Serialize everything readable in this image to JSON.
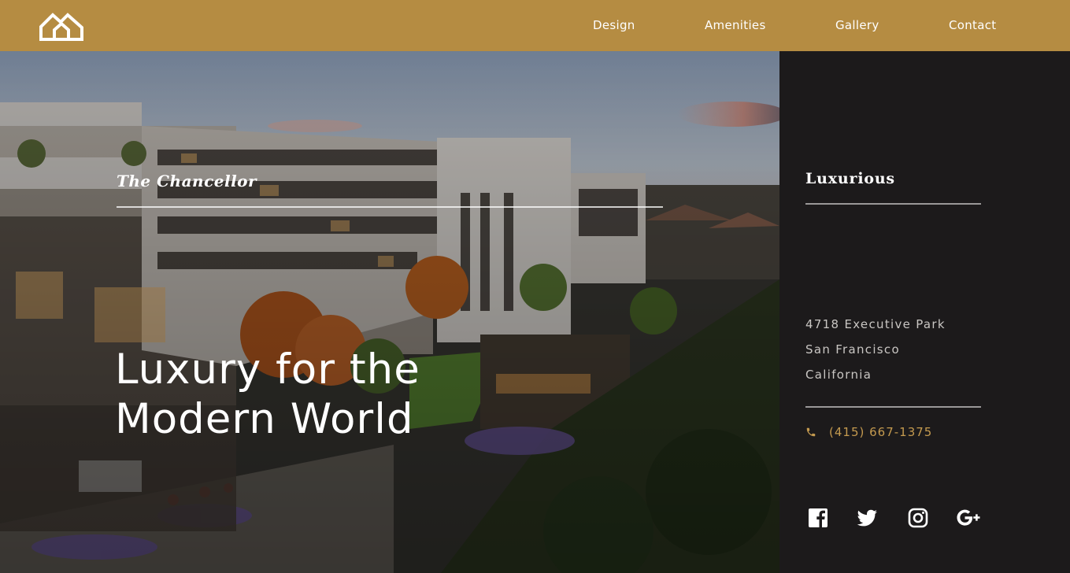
{
  "header": {
    "logo_icon": "house-outline-icon",
    "nav": [
      "Design",
      "Amenities",
      "Gallery",
      "Contact"
    ]
  },
  "hero": {
    "kicker": "The Chancellor",
    "headline_line1": "Luxury for the",
    "headline_line2": "Modern World"
  },
  "sidebar": {
    "title": "Luxurious",
    "address": [
      "4718 Executive Park",
      "San Francisco",
      "California"
    ],
    "phone": "(415) 667-1375",
    "phone_icon": "phone-icon",
    "social": [
      "facebook-icon",
      "twitter-icon",
      "instagram-icon",
      "google-plus-icon"
    ]
  },
  "colors": {
    "brand_gold": "#b58c42",
    "sidebar_bg": "#1c1a1b",
    "phone_text": "#c49a4f"
  }
}
